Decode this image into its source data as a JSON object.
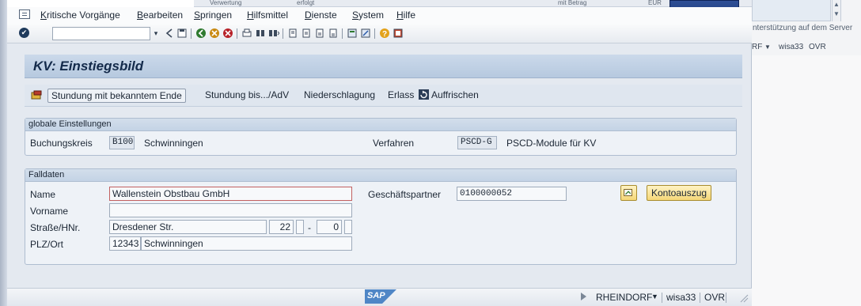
{
  "background_window": {
    "top_strip": [
      "Verwertung",
      "erfolgt",
      "mit Betrag",
      "EUR"
    ],
    "scroll_arrows": [
      "▲",
      "▼"
    ],
    "hint": "nterstützung auf dem Server",
    "status": {
      "system": "RF",
      "client": "wisa33",
      "mode": "OVR"
    }
  },
  "window_controls": [
    "_",
    "□",
    "x"
  ],
  "menubar": {
    "items": [
      "Kritische Vorgänge",
      "Bearbeiten",
      "Springen",
      "Hilfsmittel",
      "Dienste",
      "System",
      "Hilfe"
    ]
  },
  "toolbar": {
    "command_field_value": "",
    "dropdown_glyph": "▾",
    "icons": [
      "back-icon",
      "save-icon",
      "back-green-icon",
      "exit-icon",
      "cancel-icon",
      "print-icon",
      "find-icon",
      "find-next-icon",
      "first-page-icon",
      "prev-page-icon",
      "next-page-icon",
      "last-page-icon",
      "create-session-icon",
      "shortcut-icon",
      "help-icon",
      "layout-icon"
    ]
  },
  "title": "KV: Einstiegsbild",
  "application_toolbar": {
    "stundung_button": "Stundung mit bekanntem Ende",
    "stundung_adv": "Stundung bis.../AdV",
    "niederschlagung": "Niederschlagung",
    "erlass": "Erlass",
    "auffrischen": "Auffrischen"
  },
  "global_settings": {
    "heading": "globale Einstellungen",
    "buchungskreis_label": "Buchungskreis",
    "buchungskreis_value": "B100",
    "buchungskreis_text": "Schwinningen",
    "verfahren_label": "Verfahren",
    "verfahren_value": "PSCD-G",
    "verfahren_text": "PSCD-Module für KV"
  },
  "falldaten": {
    "heading": "Falldaten",
    "name_label": "Name",
    "name_value": "Wallenstein Obstbau GmbH",
    "vorname_label": "Vorname",
    "vorname_value": "",
    "strasse_label": "Straße/HNr.",
    "strasse_value": "Dresdener Str.",
    "hausnummer": "22",
    "hausnummer_sep": "-",
    "hausnummer_bis": "0",
    "plz_label": "PLZ/Ort",
    "plz_value": "12343",
    "ort_value": "Schwinningen",
    "gp_label": "Geschäftspartner",
    "gp_value": "0100000052",
    "kontoauszug_button": "Kontoauszug"
  },
  "statusbar": {
    "logo": "SAP",
    "system": "RHEINDORF",
    "dropdown_glyph": "▼",
    "client": "wisa33",
    "mode": "OVR"
  }
}
